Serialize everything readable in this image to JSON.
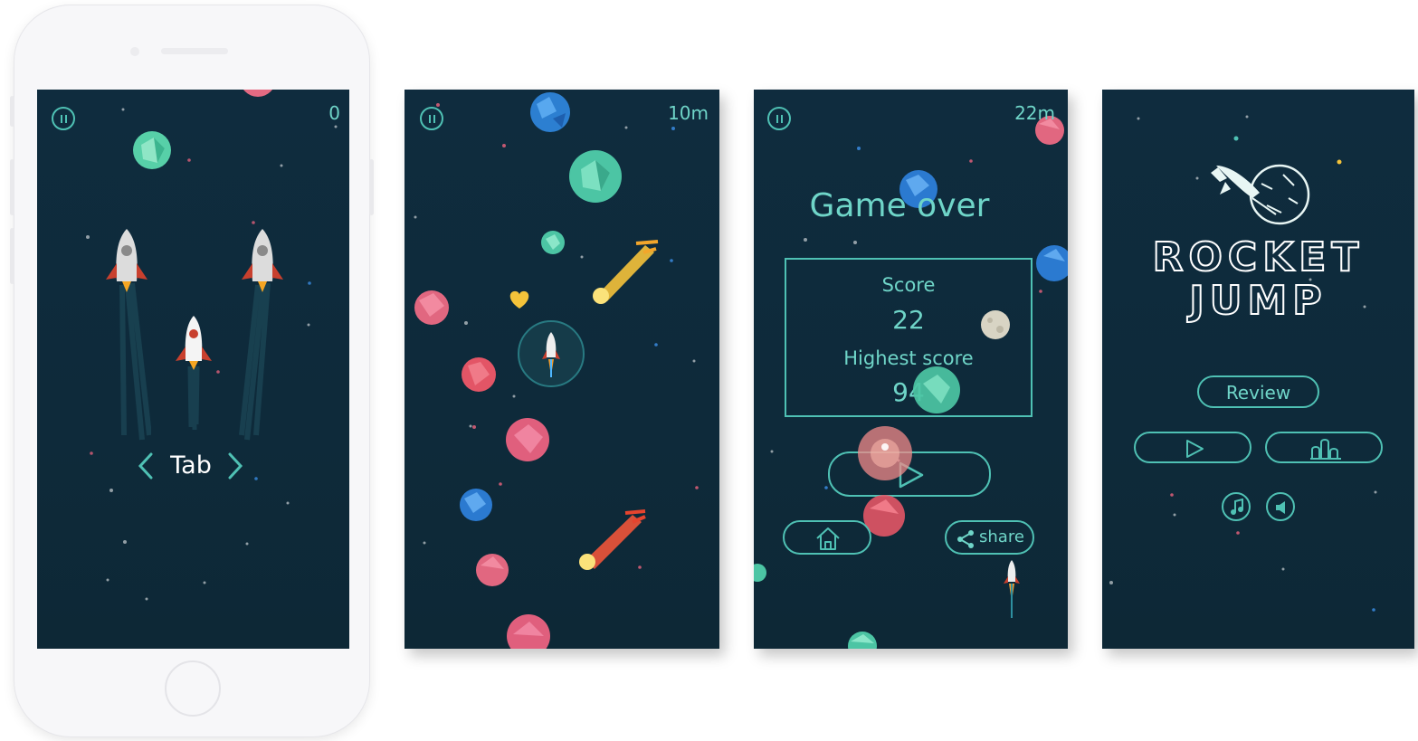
{
  "screens": {
    "start": {
      "score": "0",
      "tab_label": "Tab"
    },
    "play": {
      "distance": "10m"
    },
    "gameover": {
      "distance": "22m",
      "title": "Game over",
      "score_label": "Score",
      "score_value": "22",
      "highest_label": "Highest score",
      "highest_value": "94",
      "share_label": "share"
    },
    "menu": {
      "logo_line1": "ROCKET",
      "logo_line2": "JUMP",
      "review_label": "Review"
    }
  },
  "icons": {
    "pause": "pause-icon",
    "play": "play-icon",
    "ranking": "ranking-icon",
    "home": "home-icon",
    "share": "share-icon",
    "music": "music-note-icon",
    "sound": "speaker-icon",
    "prev": "chevron-left-icon",
    "next": "chevron-right-icon"
  },
  "colors": {
    "background": "#0e2a3a",
    "accent": "#4fc1b4",
    "text": "#6fd5c8"
  }
}
